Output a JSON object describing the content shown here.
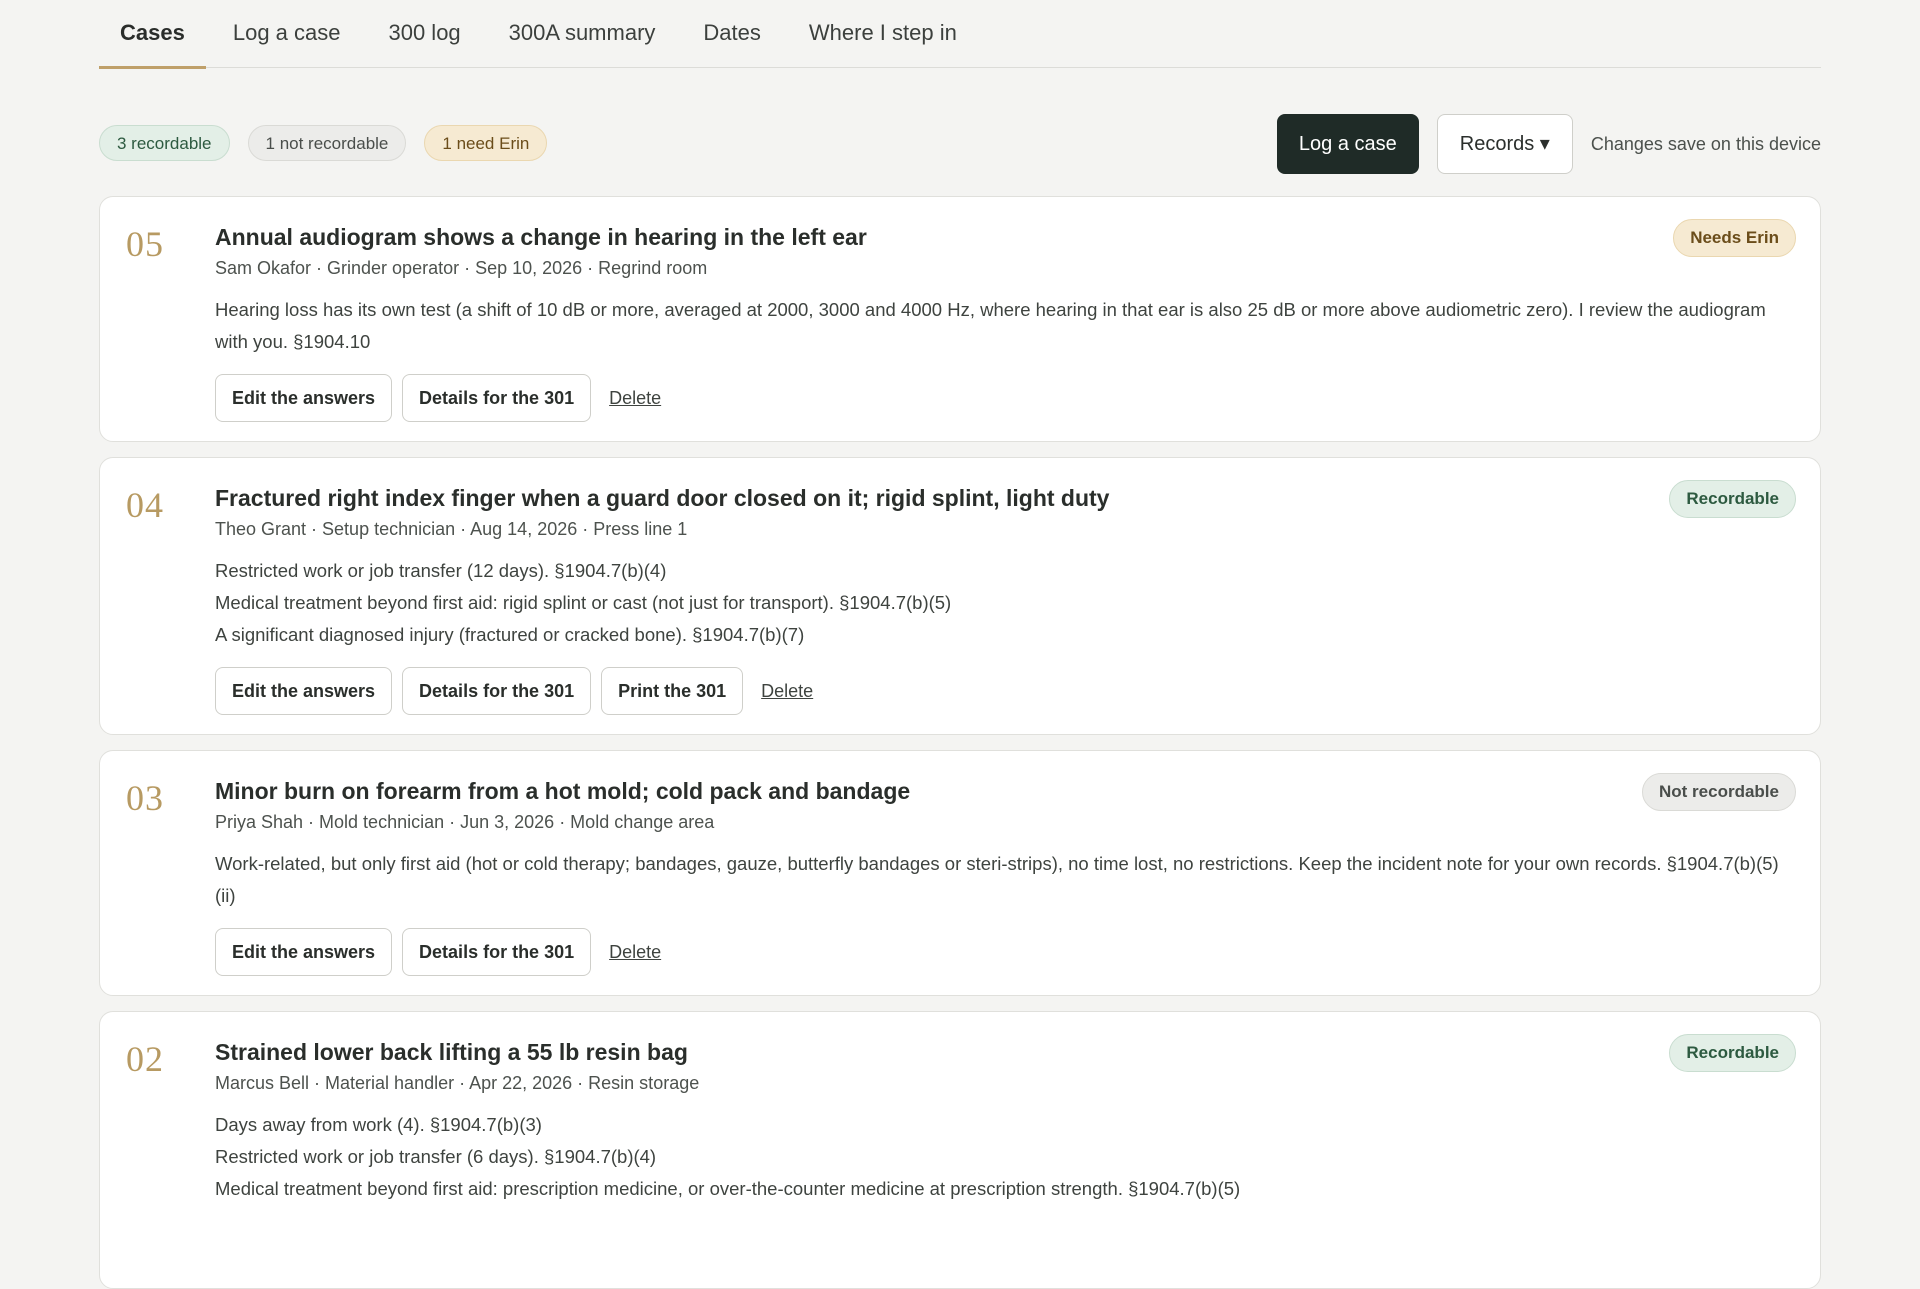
{
  "tabs": [
    {
      "label": "Cases"
    },
    {
      "label": "Log a case"
    },
    {
      "label": "300 log"
    },
    {
      "label": "300A summary"
    },
    {
      "label": "Dates"
    },
    {
      "label": "Where I step in"
    }
  ],
  "chips": {
    "recordable": "3 recordable",
    "not_recordable": "1 not recordable",
    "need_erin": "1 need Erin"
  },
  "toolbar": {
    "log_case": "Log a case",
    "records": "Records ▾",
    "save_note": "Changes save on this device"
  },
  "labels": {
    "edit": "Edit the answers",
    "details": "Details for the 301",
    "print": "Print the 301",
    "delete": "Delete"
  },
  "cases": [
    {
      "num": "05",
      "badge": "Needs Erin",
      "title": "Annual audiogram shows a change in hearing in the left ear",
      "meta": "Sam Okafor · Grinder operator · Sep 10, 2026 · Regrind room",
      "lines": [
        "Hearing loss has its own test (a shift of 10 dB or more, averaged at 2000, 3000 and 4000 Hz, where hearing in that ear is also 25 dB or more above audiometric zero). I review the audiogram with you. §1904.10"
      ]
    },
    {
      "num": "04",
      "badge": "Recordable",
      "title": "Fractured right index finger when a guard door closed on it; rigid splint, light duty",
      "meta": "Theo Grant · Setup technician · Aug 14, 2026 · Press line 1",
      "lines": [
        "Restricted work or job transfer (12 days). §1904.7(b)(4)",
        "Medical treatment beyond first aid: rigid splint or cast (not just for transport). §1904.7(b)(5)",
        "A significant diagnosed injury (fractured or cracked bone). §1904.7(b)(7)"
      ]
    },
    {
      "num": "03",
      "badge": "Not recordable",
      "title": "Minor burn on forearm from a hot mold; cold pack and bandage",
      "meta": "Priya Shah · Mold technician · Jun 3, 2026 · Mold change area",
      "lines": [
        "Work-related, but only first aid (hot or cold therapy; bandages, gauze, butterfly bandages or steri-strips), no time lost, no restrictions. Keep the incident note for your own records. §1904.7(b)(5)(ii)"
      ]
    },
    {
      "num": "02",
      "badge": "Recordable",
      "title": "Strained lower back lifting a 55 lb resin bag",
      "meta": "Marcus Bell · Material handler · Apr 22, 2026 · Resin storage",
      "lines": [
        "Days away from work (4). §1904.7(b)(3)",
        "Restricted work or job transfer (6 days). §1904.7(b)(4)",
        "Medical treatment beyond first aid: prescription medicine, or over-the-counter medicine at prescription strength. §1904.7(b)(5)"
      ]
    }
  ]
}
